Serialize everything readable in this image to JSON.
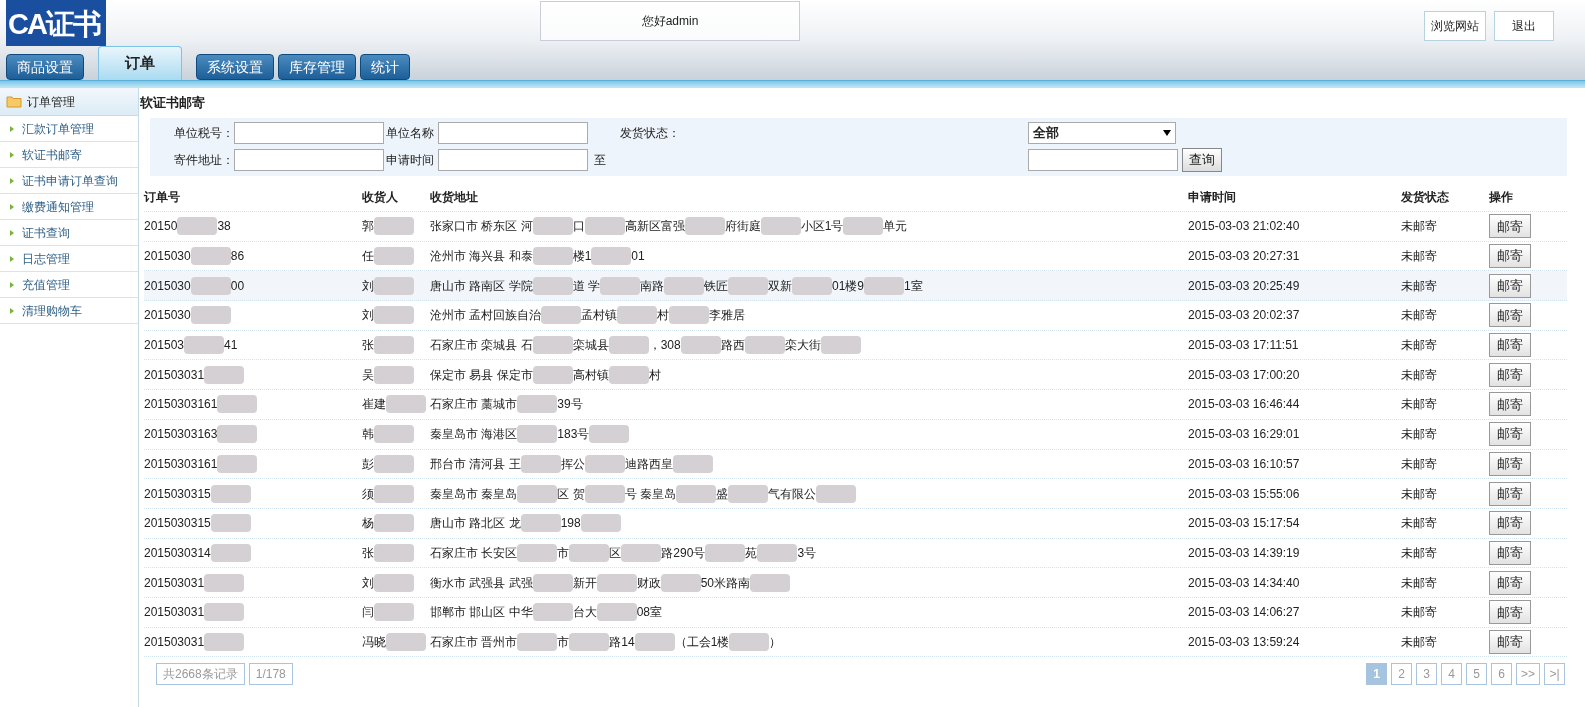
{
  "logo": "CA证书",
  "greeting": "您好admin",
  "header_buttons": [
    "浏览网站",
    "退出"
  ],
  "tabs": [
    {
      "label": "商品设置",
      "selected": false
    },
    {
      "label": "订单",
      "selected": true
    },
    {
      "label": "系统设置",
      "selected": false
    },
    {
      "label": "库存管理",
      "selected": false
    },
    {
      "label": "统计",
      "selected": false
    }
  ],
  "sidebar": {
    "title": "订单管理",
    "items": [
      {
        "label": "汇款订单管理",
        "selected": false
      },
      {
        "label": "软证书邮寄",
        "selected": false
      },
      {
        "label": "证书申请订单查询",
        "selected": false
      },
      {
        "label": "缴费通知管理",
        "selected": false
      },
      {
        "label": "证书查询",
        "selected": false
      },
      {
        "label": "日志管理",
        "selected": false
      },
      {
        "label": "充值管理",
        "selected": false
      },
      {
        "label": "清理购物车",
        "selected": false
      }
    ]
  },
  "page_title": "软证书邮寄",
  "filters": {
    "tax_no_label": "单位税号：",
    "name_label": "单位名称",
    "status_label": "发货状态：",
    "status_value": "全部",
    "address_label": "寄件地址：",
    "time_label": "申请时间",
    "to_label": "至",
    "query_button": "查询"
  },
  "table": {
    "columns": [
      "订单号",
      "收货人",
      "收货地址",
      "申请时间",
      "发货状态",
      "操作"
    ],
    "rows": [
      {
        "selected": false,
        "order": [
          {
            "kind": "text",
            "text": "20150"
          },
          {
            "kind": "blur"
          },
          {
            "kind": "text",
            "text": "38"
          }
        ],
        "name": [
          {
            "kind": "text",
            "text": "郭"
          },
          {
            "kind": "blur"
          }
        ],
        "address": [
          {
            "kind": "text",
            "text": "张家口市 桥东区 河"
          },
          {
            "kind": "blur"
          },
          {
            "kind": "text",
            "text": "口"
          },
          {
            "kind": "blur"
          },
          {
            "kind": "text",
            "text": "高新区富强"
          },
          {
            "kind": "blur"
          },
          {
            "kind": "text",
            "text": "府街庭"
          },
          {
            "kind": "blur"
          },
          {
            "kind": "text",
            "text": "小区1号"
          },
          {
            "kind": "blur"
          },
          {
            "kind": "text",
            "text": "单元"
          }
        ],
        "time": "2015-03-03 21:02:40",
        "status": "未邮寄",
        "action": "邮寄"
      },
      {
        "selected": false,
        "order": [
          {
            "kind": "text",
            "text": "2015030"
          },
          {
            "kind": "blur"
          },
          {
            "kind": "text",
            "text": "86"
          }
        ],
        "name": [
          {
            "kind": "text",
            "text": "任"
          },
          {
            "kind": "blur"
          }
        ],
        "address": [
          {
            "kind": "text",
            "text": "沧州市 海兴县 和泰"
          },
          {
            "kind": "blur"
          },
          {
            "kind": "text",
            "text": "楼1"
          },
          {
            "kind": "blur"
          },
          {
            "kind": "text",
            "text": "01"
          }
        ],
        "time": "2015-03-03 20:27:31",
        "status": "未邮寄",
        "action": "邮寄"
      },
      {
        "selected": true,
        "order": [
          {
            "kind": "text",
            "text": "2015030"
          },
          {
            "kind": "blur"
          },
          {
            "kind": "text",
            "text": "00"
          }
        ],
        "name": [
          {
            "kind": "text",
            "text": "刘"
          },
          {
            "kind": "blur"
          }
        ],
        "address": [
          {
            "kind": "text",
            "text": "唐山市 路南区 学院"
          },
          {
            "kind": "blur"
          },
          {
            "kind": "text",
            "text": "道 学"
          },
          {
            "kind": "blur"
          },
          {
            "kind": "text",
            "text": "南路"
          },
          {
            "kind": "blur"
          },
          {
            "kind": "text",
            "text": "铁匠"
          },
          {
            "kind": "blur"
          },
          {
            "kind": "text",
            "text": "双新"
          },
          {
            "kind": "blur"
          },
          {
            "kind": "text",
            "text": "01楼9"
          },
          {
            "kind": "blur"
          },
          {
            "kind": "text",
            "text": "1室"
          }
        ],
        "time": "2015-03-03 20:25:49",
        "status": "未邮寄",
        "action": "邮寄"
      },
      {
        "selected": false,
        "order": [
          {
            "kind": "text",
            "text": "2015030"
          },
          {
            "kind": "blur"
          }
        ],
        "name": [
          {
            "kind": "text",
            "text": "刘"
          },
          {
            "kind": "blur"
          }
        ],
        "address": [
          {
            "kind": "text",
            "text": "沧州市 孟村回族自治"
          },
          {
            "kind": "blur"
          },
          {
            "kind": "text",
            "text": "孟村镇"
          },
          {
            "kind": "blur"
          },
          {
            "kind": "text",
            "text": "村"
          },
          {
            "kind": "blur"
          },
          {
            "kind": "text",
            "text": "李雅居"
          }
        ],
        "time": "2015-03-03 20:02:37",
        "status": "未邮寄",
        "action": "邮寄"
      },
      {
        "selected": false,
        "order": [
          {
            "kind": "text",
            "text": "201503"
          },
          {
            "kind": "blur"
          },
          {
            "kind": "text",
            "text": "41"
          }
        ],
        "name": [
          {
            "kind": "text",
            "text": "张"
          },
          {
            "kind": "blur"
          }
        ],
        "address": [
          {
            "kind": "text",
            "text": "石家庄市 栾城县 石"
          },
          {
            "kind": "blur"
          },
          {
            "kind": "text",
            "text": "栾城县"
          },
          {
            "kind": "blur"
          },
          {
            "kind": "text",
            "text": "，308"
          },
          {
            "kind": "blur"
          },
          {
            "kind": "text",
            "text": "路西"
          },
          {
            "kind": "blur"
          },
          {
            "kind": "text",
            "text": "栾大街"
          },
          {
            "kind": "blur"
          }
        ],
        "time": "2015-03-03 17:11:51",
        "status": "未邮寄",
        "action": "邮寄"
      },
      {
        "selected": false,
        "order": [
          {
            "kind": "text",
            "text": "201503031"
          },
          {
            "kind": "blur"
          }
        ],
        "name": [
          {
            "kind": "text",
            "text": "吴"
          },
          {
            "kind": "blur"
          }
        ],
        "address": [
          {
            "kind": "text",
            "text": "保定市 易县 保定市"
          },
          {
            "kind": "blur"
          },
          {
            "kind": "text",
            "text": "高村镇"
          },
          {
            "kind": "blur"
          },
          {
            "kind": "text",
            "text": "村"
          }
        ],
        "time": "2015-03-03 17:00:20",
        "status": "未邮寄",
        "action": "邮寄"
      },
      {
        "selected": false,
        "order": [
          {
            "kind": "text",
            "text": "20150303161"
          },
          {
            "kind": "blur"
          }
        ],
        "name": [
          {
            "kind": "text",
            "text": "崔建"
          },
          {
            "kind": "blur"
          }
        ],
        "address": [
          {
            "kind": "text",
            "text": "石家庄市 藁城市"
          },
          {
            "kind": "blur"
          },
          {
            "kind": "text",
            "text": "39号"
          }
        ],
        "time": "2015-03-03 16:46:44",
        "status": "未邮寄",
        "action": "邮寄"
      },
      {
        "selected": false,
        "order": [
          {
            "kind": "text",
            "text": "20150303163"
          },
          {
            "kind": "blur"
          }
        ],
        "name": [
          {
            "kind": "text",
            "text": "韩"
          },
          {
            "kind": "blur"
          }
        ],
        "address": [
          {
            "kind": "text",
            "text": "秦皇岛市 海港区"
          },
          {
            "kind": "blur"
          },
          {
            "kind": "text",
            "text": "183号"
          },
          {
            "kind": "blur"
          }
        ],
        "time": "2015-03-03 16:29:01",
        "status": "未邮寄",
        "action": "邮寄"
      },
      {
        "selected": false,
        "order": [
          {
            "kind": "text",
            "text": "20150303161"
          },
          {
            "kind": "blur"
          }
        ],
        "name": [
          {
            "kind": "text",
            "text": "彭"
          },
          {
            "kind": "blur"
          }
        ],
        "address": [
          {
            "kind": "text",
            "text": "邢台市 清河县 王"
          },
          {
            "kind": "blur"
          },
          {
            "kind": "text",
            "text": "挥公"
          },
          {
            "kind": "blur"
          },
          {
            "kind": "text",
            "text": "迪路西皇"
          },
          {
            "kind": "blur"
          }
        ],
        "time": "2015-03-03 16:10:57",
        "status": "未邮寄",
        "action": "邮寄"
      },
      {
        "selected": false,
        "order": [
          {
            "kind": "text",
            "text": "2015030315"
          },
          {
            "kind": "blur"
          }
        ],
        "name": [
          {
            "kind": "text",
            "text": "须"
          },
          {
            "kind": "blur"
          }
        ],
        "address": [
          {
            "kind": "text",
            "text": "秦皇岛市 秦皇岛"
          },
          {
            "kind": "blur"
          },
          {
            "kind": "text",
            "text": "区 贺"
          },
          {
            "kind": "blur"
          },
          {
            "kind": "text",
            "text": "号 秦皇岛"
          },
          {
            "kind": "blur"
          },
          {
            "kind": "text",
            "text": "盛"
          },
          {
            "kind": "blur"
          },
          {
            "kind": "text",
            "text": "气有限公"
          },
          {
            "kind": "blur"
          }
        ],
        "time": "2015-03-03 15:55:06",
        "status": "未邮寄",
        "action": "邮寄"
      },
      {
        "selected": false,
        "order": [
          {
            "kind": "text",
            "text": "2015030315"
          },
          {
            "kind": "blur"
          }
        ],
        "name": [
          {
            "kind": "text",
            "text": "杨"
          },
          {
            "kind": "blur"
          }
        ],
        "address": [
          {
            "kind": "text",
            "text": "唐山市 路北区 龙"
          },
          {
            "kind": "blur"
          },
          {
            "kind": "text",
            "text": "198"
          },
          {
            "kind": "blur"
          }
        ],
        "time": "2015-03-03 15:17:54",
        "status": "未邮寄",
        "action": "邮寄"
      },
      {
        "selected": false,
        "order": [
          {
            "kind": "text",
            "text": "2015030314"
          },
          {
            "kind": "blur"
          }
        ],
        "name": [
          {
            "kind": "text",
            "text": "张"
          },
          {
            "kind": "blur"
          }
        ],
        "address": [
          {
            "kind": "text",
            "text": "石家庄市 长安区"
          },
          {
            "kind": "blur"
          },
          {
            "kind": "text",
            "text": "市"
          },
          {
            "kind": "blur"
          },
          {
            "kind": "text",
            "text": "区"
          },
          {
            "kind": "blur"
          },
          {
            "kind": "text",
            "text": "路290号"
          },
          {
            "kind": "blur"
          },
          {
            "kind": "text",
            "text": "苑"
          },
          {
            "kind": "blur"
          },
          {
            "kind": "text",
            "text": "3号"
          }
        ],
        "time": "2015-03-03 14:39:19",
        "status": "未邮寄",
        "action": "邮寄"
      },
      {
        "selected": false,
        "order": [
          {
            "kind": "text",
            "text": "201503031"
          },
          {
            "kind": "blur"
          }
        ],
        "name": [
          {
            "kind": "text",
            "text": "刘"
          },
          {
            "kind": "blur"
          }
        ],
        "address": [
          {
            "kind": "text",
            "text": "衡水市 武强县 武强"
          },
          {
            "kind": "blur"
          },
          {
            "kind": "text",
            "text": "新开"
          },
          {
            "kind": "blur"
          },
          {
            "kind": "text",
            "text": "财政"
          },
          {
            "kind": "blur"
          },
          {
            "kind": "text",
            "text": "50米路南"
          },
          {
            "kind": "blur"
          }
        ],
        "time": "2015-03-03 14:34:40",
        "status": "未邮寄",
        "action": "邮寄"
      },
      {
        "selected": false,
        "order": [
          {
            "kind": "text",
            "text": "201503031"
          },
          {
            "kind": "blur"
          }
        ],
        "name": [
          {
            "kind": "text",
            "text": "闫"
          },
          {
            "kind": "blur"
          }
        ],
        "address": [
          {
            "kind": "text",
            "text": "邯郸市 邯山区 中华"
          },
          {
            "kind": "blur"
          },
          {
            "kind": "text",
            "text": "台大"
          },
          {
            "kind": "blur"
          },
          {
            "kind": "text",
            "text": "08室"
          }
        ],
        "time": "2015-03-03 14:06:27",
        "status": "未邮寄",
        "action": "邮寄"
      },
      {
        "selected": false,
        "order": [
          {
            "kind": "text",
            "text": "201503031"
          },
          {
            "kind": "blur"
          }
        ],
        "name": [
          {
            "kind": "text",
            "text": "冯晓"
          },
          {
            "kind": "blur"
          }
        ],
        "address": [
          {
            "kind": "text",
            "text": "石家庄市 晋州市"
          },
          {
            "kind": "blur"
          },
          {
            "kind": "text",
            "text": "市"
          },
          {
            "kind": "blur"
          },
          {
            "kind": "text",
            "text": "路14"
          },
          {
            "kind": "blur"
          },
          {
            "kind": "text",
            "text": "（工会1楼"
          },
          {
            "kind": "blur"
          },
          {
            "kind": "text",
            "text": "）"
          }
        ],
        "time": "2015-03-03 13:59:24",
        "status": "未邮寄",
        "action": "邮寄"
      }
    ]
  },
  "pagination": {
    "total": "共2668条记录",
    "page_of": "1/178",
    "pages": [
      {
        "label": "1",
        "selected": true
      },
      {
        "label": "2",
        "selected": false
      },
      {
        "label": "3",
        "selected": false
      },
      {
        "label": "4",
        "selected": false
      },
      {
        "label": "5",
        "selected": false
      },
      {
        "label": "6",
        "selected": false
      },
      {
        "label": ">>",
        "selected": false
      },
      {
        "label": ">|",
        "selected": false
      }
    ]
  }
}
